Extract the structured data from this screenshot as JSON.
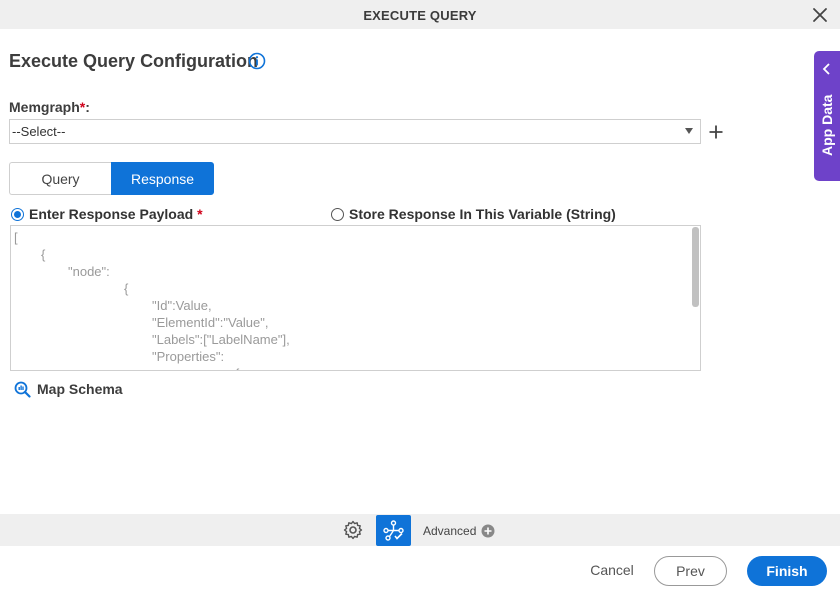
{
  "window": {
    "title": "EXECUTE QUERY",
    "close_icon": "close-icon"
  },
  "header": {
    "title": "Execute Query Configuration",
    "info_icon": "info-icon"
  },
  "app_data_panel": {
    "label": "App Data",
    "icon": "chevron-left-icon",
    "color": "#6e42c9"
  },
  "memgraph": {
    "label": "Memgraph",
    "required_mark": "*",
    "colon": ":",
    "selected_value": "--Select--",
    "add_icon": "plus-icon"
  },
  "tabs": [
    {
      "label": "Query",
      "active": false
    },
    {
      "label": "Response",
      "active": true
    }
  ],
  "response_options": {
    "payload": {
      "label": "Enter Response Payload",
      "required_mark": "*",
      "selected": true
    },
    "variable": {
      "label": "Store Response In This Variable (String)",
      "selected": false
    }
  },
  "payload_lines": [
    "[",
    "{",
    "\"node\":",
    "{",
    "\"Id\":Value,",
    "\"ElementId\":\"Value\",",
    "\"Labels\":[\"LabelName\"],",
    "\"Properties\":",
    "{"
  ],
  "map_schema": {
    "label": "Map Schema",
    "icon": "search-schema-icon"
  },
  "toolbar": {
    "settings_icon": "gear-icon",
    "flow_icon": "process-flow-icon",
    "advanced_label": "Advanced",
    "advanced_icon": "plus-circle-icon"
  },
  "actions": {
    "cancel_label": "Cancel",
    "prev_label": "Prev",
    "finish_label": "Finish"
  },
  "colors": {
    "accent": "#0f73d8",
    "required": "#d0021b",
    "app_data": "#6e42c9"
  }
}
